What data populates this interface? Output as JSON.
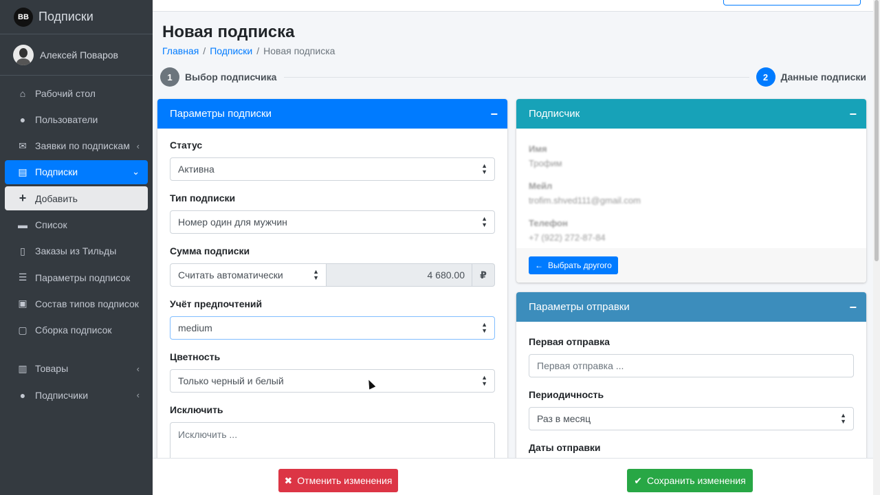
{
  "brand": {
    "logo": "BB",
    "title": "Подписки"
  },
  "user": {
    "name": "Алексей Поваров"
  },
  "sidebar": {
    "items": [
      {
        "label": "Рабочий стол",
        "icon": "home-icon"
      },
      {
        "label": "Пользователи",
        "icon": "users-icon"
      },
      {
        "label": "Заявки по подпискам",
        "icon": "envelope-icon"
      },
      {
        "label": "Подписки",
        "icon": "id-card-icon"
      },
      {
        "label": "Добавить",
        "icon": "plus-icon"
      },
      {
        "label": "Список",
        "icon": "list-icon"
      },
      {
        "label": "Заказы из Тильды",
        "icon": "file-icon"
      },
      {
        "label": "Параметры подписок",
        "icon": "sliders-icon"
      },
      {
        "label": "Состав типов подписок",
        "icon": "boxes-icon"
      },
      {
        "label": "Сборка подписок",
        "icon": "box-icon"
      },
      {
        "label": "Товары",
        "icon": "cart-icon"
      },
      {
        "label": "Подписчики",
        "icon": "users-icon"
      }
    ]
  },
  "page": {
    "title": "Новая подписка",
    "breadcrumb": {
      "home": "Главная",
      "subs": "Подписки",
      "current": "Новая подписка"
    }
  },
  "stepper": {
    "step1": {
      "num": "1",
      "label": "Выбор подписчика"
    },
    "step2": {
      "num": "2",
      "label": "Данные подписки"
    }
  },
  "params_card": {
    "title": "Параметры подписки",
    "status_label": "Статус",
    "status_value": "Активна",
    "type_label": "Тип подписки",
    "type_value": "Номер один для мужчин",
    "sum_label": "Сумма подписки",
    "sum_mode": "Считать автоматически",
    "sum_value": "4 680.00",
    "currency": "₽",
    "pref_label": "Учёт предпочтений",
    "pref_value": "medium",
    "color_label": "Цветность",
    "color_value": "Только черный и белый",
    "exclude_label": "Исключить",
    "exclude_placeholder": "Исключить ..."
  },
  "subscriber_card": {
    "title": "Подписчик",
    "name_label": "Имя",
    "name_value": "Трофим",
    "email_label": "Мейл",
    "email_value": "trofim.shved111@gmail.com",
    "phone_label": "Телефон",
    "phone_value": "+7 (922) 272-87-84",
    "choose_other": "Выбрать другого"
  },
  "shipping_card": {
    "title": "Параметры отправки",
    "first_label": "Первая отправка",
    "first_placeholder": "Первая отправка ...",
    "period_label": "Периодичность",
    "period_value": "Раз в месяц",
    "dates_label": "Даты отправки"
  },
  "actions": {
    "cancel": "Отменить изменения",
    "save": "Сохранить изменения"
  },
  "colors": {
    "primary": "#007bff",
    "teal": "#17a2b8",
    "steel": "#3c8dbc",
    "danger": "#dc3545",
    "success": "#28a745",
    "sidebar": "#343a40"
  }
}
